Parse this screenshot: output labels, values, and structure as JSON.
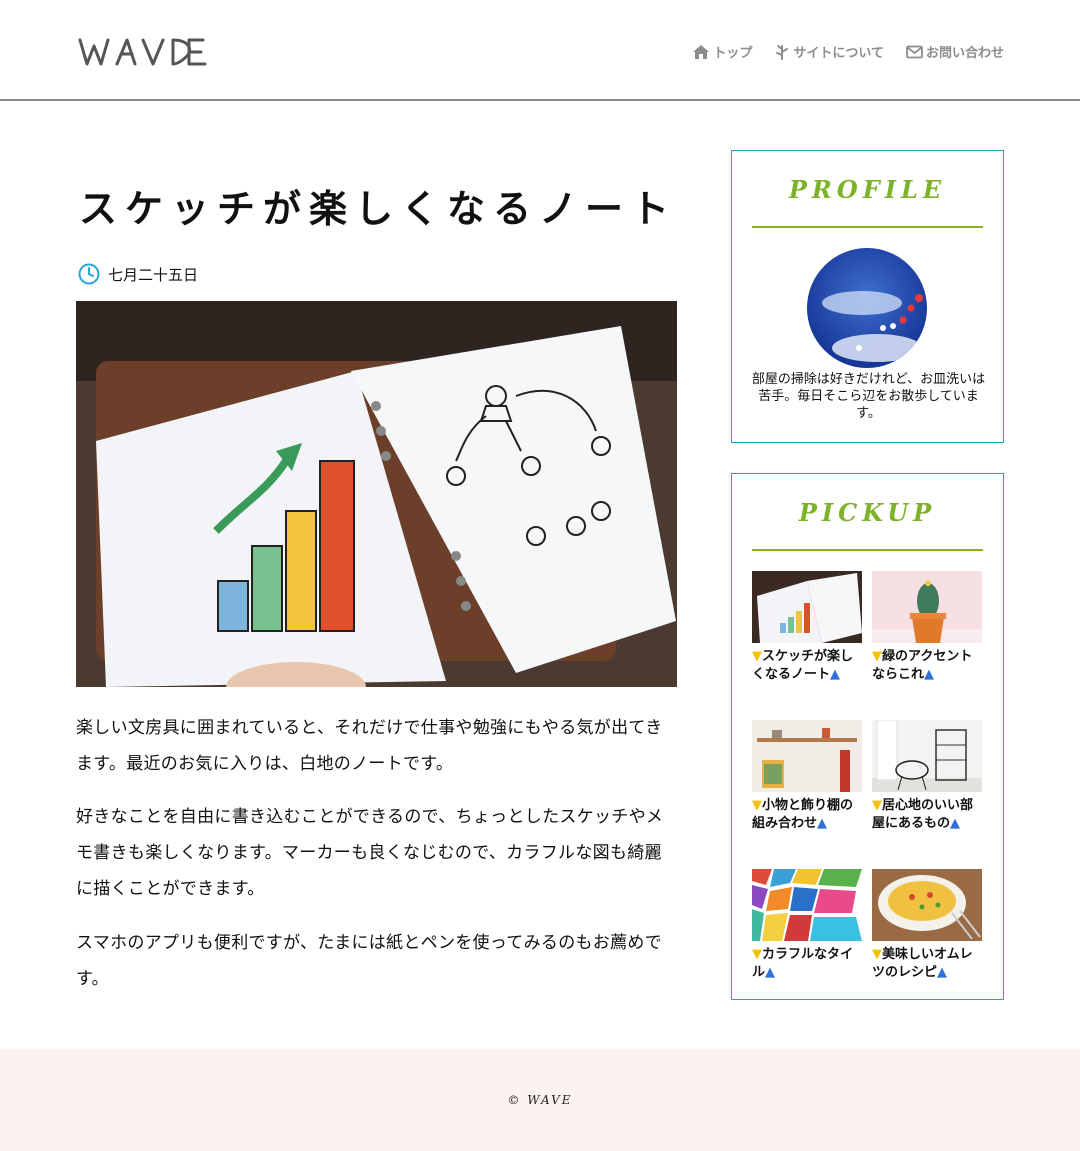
{
  "site": {
    "logo_text": "WAVE"
  },
  "nav": [
    {
      "label": "トップ",
      "icon": "home-icon"
    },
    {
      "label": "サイトについて",
      "icon": "leaf-icon"
    },
    {
      "label": "お問い合わせ",
      "icon": "mail-icon"
    }
  ],
  "article": {
    "title": "スケッチが楽しくなるノート",
    "date": "七月二十五日",
    "paragraphs": [
      "楽しい文房具に囲まれていると、それだけで仕事や勉強にもやる気が出てきます。最近のお気に入りは、白地のノートです。",
      "好きなことを自由に書き込むことができるので、ちょっとしたスケッチやメモ書きも楽しくなります。マーカーも良くなじむので、カラフルな図も綺麗に描くことができます。",
      "スマホのアプリも便利ですが、たまには紙とペンを使ってみるのもお薦めです。"
    ]
  },
  "profile": {
    "heading": "PROFILE",
    "text": "部屋の掃除は好きだけれど、お皿洗いは苦手。毎日そこら辺をお散歩しています。"
  },
  "pickup": {
    "heading": "PICKUP",
    "marker_down": "▼",
    "marker_up": "▲",
    "items": [
      {
        "title": "スケッチが楽しくなるノート"
      },
      {
        "title": "緑のアクセントならこれ"
      },
      {
        "title": "小物と飾り棚の組み合わせ"
      },
      {
        "title": "居心地のいい部屋にあるもの"
      },
      {
        "title": "カラフルなタイル"
      },
      {
        "title": "美味しいオムレツのレシピ"
      }
    ]
  },
  "footer": {
    "copyright": "© WAVE"
  },
  "colors": {
    "accent_green": "#86b31f",
    "border_blue": "#1ea0c3",
    "nav_gray": "#8c8c8c",
    "footer_bg": "#fdf2f2"
  }
}
